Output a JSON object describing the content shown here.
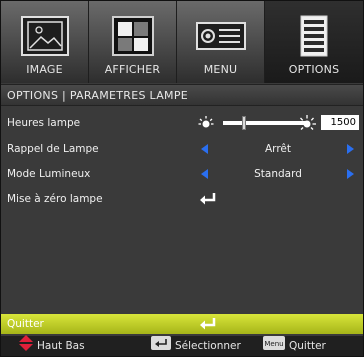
{
  "tabs": [
    {
      "label": "IMAGE",
      "icon": "picture-frame-icon"
    },
    {
      "label": "AFFICHER",
      "icon": "display-icon"
    },
    {
      "label": "MENU",
      "icon": "projector-icon"
    },
    {
      "label": "OPTIONS",
      "icon": "options-list-icon"
    }
  ],
  "active_tab": "OPTIONS",
  "subtitle": "OPTIONS | PARAMETRES LAMPE",
  "rows": {
    "lamp_hours": {
      "label": "Heures lampe",
      "value": "1500",
      "level": 0.25
    },
    "lamp_reminder": {
      "label": "Rappel de Lampe",
      "value": "Arrêt"
    },
    "brightness_mode": {
      "label": "Mode Lumineux",
      "value": "Standard"
    },
    "lamp_reset": {
      "label": "Mise à zéro lampe"
    }
  },
  "quit": {
    "label": "Quitter"
  },
  "help": {
    "updown": "Haut Bas",
    "select": "Sélectionner",
    "menu_key": "Menu",
    "quit": "Quitter"
  },
  "colors": {
    "accent_blue": "#2a6ff0",
    "quit_bar": "#c2d02a",
    "updown_red": "#e0203a",
    "background": "#3a3a3a"
  }
}
